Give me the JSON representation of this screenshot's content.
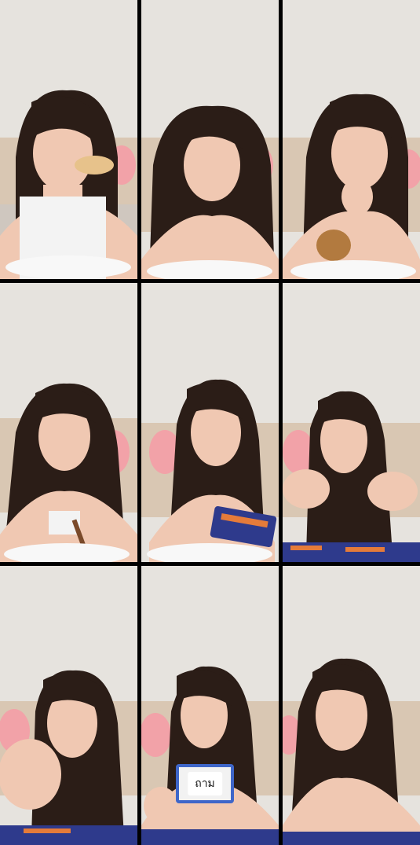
{
  "grid": {
    "rows": 3,
    "cols": 3,
    "cards_text": "ถาม"
  },
  "colors": {
    "wall": "#e6e3de",
    "sofa": "#d9c7b3",
    "hair": "#2b1d17",
    "skin": "#f0c8b2",
    "plush": "#f2a2a8",
    "cardblue": "#2e3a8c",
    "cardorange": "#e57b3a"
  }
}
